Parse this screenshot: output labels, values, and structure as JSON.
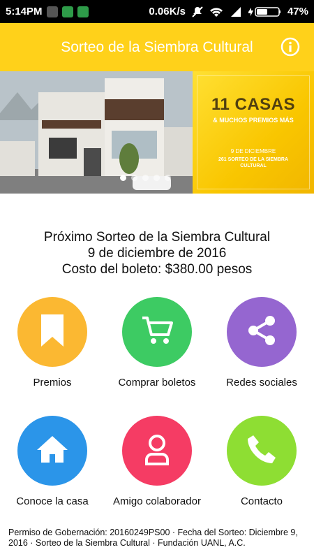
{
  "status_bar": {
    "time": "5:14PM",
    "speed": "0.06K/s",
    "battery": "47%"
  },
  "app_bar": {
    "title": "Sorteo de la Siembra Cultural",
    "info_icon": "info-icon"
  },
  "banner": {
    "headline": "11 CASAS",
    "subheadline": "& MUCHOS PREMIOS MÁS",
    "date": "9 DE DICIEMBRE",
    "edition": "261 SORTEO DE LA SIEMBRA CULTURAL",
    "active_slide": 1,
    "slides": 5
  },
  "info": {
    "line1": "Próximo Sorteo de la Siembra Cultural",
    "line2": "9 de diciembre de 2016",
    "line3": "Costo del boleto: $380.00 pesos"
  },
  "menu": [
    {
      "label": "Premios",
      "icon": "bookmark-icon",
      "color": "#fbb832"
    },
    {
      "label": "Comprar boletos",
      "icon": "shopping-cart-icon",
      "color": "#3dcb63"
    },
    {
      "label": "Redes sociales",
      "icon": "share-icon",
      "color": "#9566d0"
    },
    {
      "label": "Conoce la casa",
      "icon": "home-icon",
      "color": "#2b95e9"
    },
    {
      "label": "Amigo colaborador",
      "icon": "user-icon",
      "color": "#f53c64"
    },
    {
      "label": "Contacto",
      "icon": "phone-icon",
      "color": "#8ede33"
    }
  ],
  "footer": {
    "text": "Permiso de Gobernación: 20160249PS00 · Fecha del Sorteo: Diciembre 9, 2016 · Sorteo de la Siembra Cultural · Fundación UANL, A.C."
  }
}
